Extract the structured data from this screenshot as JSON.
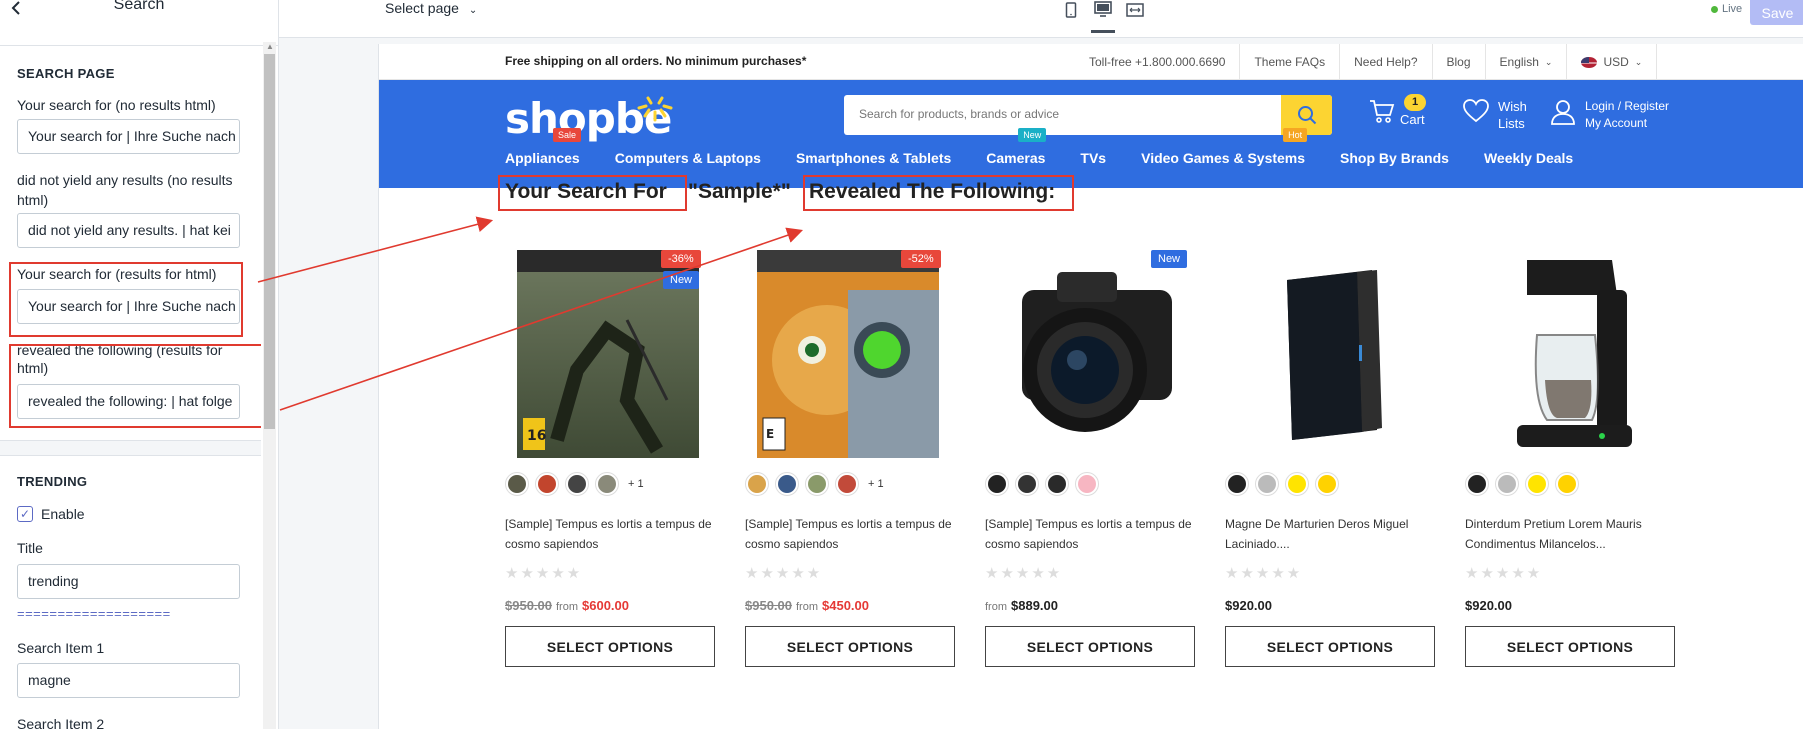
{
  "sidebar": {
    "title": "Search",
    "sections": {
      "search_page": {
        "title": "SEARCH PAGE",
        "fields": [
          {
            "label": "Your search for (no results html)",
            "value": "Your search for | Ihre Suche nach"
          },
          {
            "label": "did not yield any results (no results html)",
            "value": "did not yield any results. | hat kei"
          },
          {
            "label": "Your search for (results for html)",
            "value": "Your search for | Ihre Suche nach"
          },
          {
            "label": "revealed the following (results for html)",
            "value": "revealed the following: | hat folge"
          }
        ]
      },
      "trending": {
        "title": "TRENDING",
        "enable_label": "Enable",
        "title_label": "Title",
        "title_value": "trending",
        "divider_text": "===================",
        "item1_label": "Search Item 1",
        "item1_value": "magne",
        "item2_label": "Search Item 2"
      }
    }
  },
  "topbar": {
    "select_page": "Select page",
    "live_label": "Live",
    "save_label": "Save"
  },
  "store": {
    "shipping_text": "Free shipping on all orders. No minimum purchases*",
    "top_links": [
      "Toll-free +1.800.000.6690",
      "Theme FAQs",
      "Need Help?",
      "Blog",
      "English",
      "USD"
    ],
    "logo": "shopbe",
    "search_placeholder": "Search for products, brands or advice",
    "cart_count": "1",
    "cart_label": "Cart",
    "wish_label_1": "Wish",
    "wish_label_2": "Lists",
    "login_label": "Login / Register",
    "account_label": "My Account",
    "nav": [
      {
        "label": "Appliances",
        "tag": "Sale",
        "tag_color": "#e8473b"
      },
      {
        "label": "Computers & Laptops",
        "tag": "",
        "tag_color": ""
      },
      {
        "label": "Smartphones & Tablets",
        "tag": "",
        "tag_color": ""
      },
      {
        "label": "Cameras",
        "tag": "New",
        "tag_color": "#1ab0c7"
      },
      {
        "label": "TVs",
        "tag": "",
        "tag_color": ""
      },
      {
        "label": "Video Games & Systems",
        "tag": "Hot",
        "tag_color": "#f5a623"
      },
      {
        "label": "Shop By Brands",
        "tag": "",
        "tag_color": ""
      },
      {
        "label": "Weekly Deals",
        "tag": "",
        "tag_color": ""
      }
    ],
    "result_heading": {
      "part1": "Your Search For",
      "part2": "\"Sample*\"",
      "part3": "Revealed The Following:"
    },
    "products": [
      {
        "name": "[Sample] Tempus es lortis a tempus de cosmo sapiendos",
        "old_price": "$950.00",
        "from": "from",
        "price": "$600.00",
        "discount": "-36%",
        "label": "New",
        "more": "+ 1",
        "button": "SELECT OPTIONS"
      },
      {
        "name": "[Sample] Tempus es lortis a tempus de cosmo sapiendos",
        "old_price": "$950.00",
        "from": "from",
        "price": "$450.00",
        "discount": "-52%",
        "label": "",
        "more": "+ 1",
        "button": "SELECT OPTIONS"
      },
      {
        "name": "[Sample] Tempus es lortis a tempus de cosmo sapiendos",
        "old_price": "",
        "from": "from",
        "price": "$889.00",
        "discount": "",
        "label": "New",
        "more": "",
        "button": "SELECT OPTIONS"
      },
      {
        "name": "Magne De Marturien Deros Miguel Laciniado....",
        "old_price": "",
        "from": "",
        "price": "$920.00",
        "discount": "",
        "label": "",
        "more": "",
        "button": "SELECT OPTIONS"
      },
      {
        "name": "Dinterdum Pretium Lorem Mauris Condimentus Milancelos...",
        "old_price": "",
        "from": "",
        "price": "$920.00",
        "discount": "",
        "label": "",
        "more": "",
        "button": "SELECT OPTIONS"
      }
    ]
  },
  "colors": {
    "brand_blue": "#2f6de0",
    "accent_yellow": "#fcd432",
    "highlight_red": "#e03a2f",
    "price_red": "#e53935"
  }
}
